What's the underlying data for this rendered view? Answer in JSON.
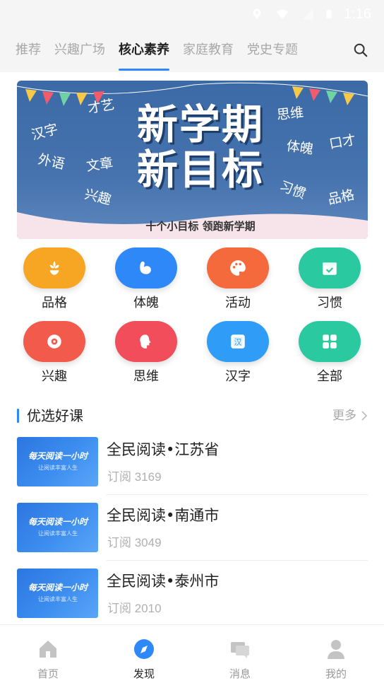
{
  "status_bar": {
    "time": "1:16"
  },
  "tabs": [
    {
      "label": "推荐"
    },
    {
      "label": "兴趣广场"
    },
    {
      "label": "核心素养",
      "active": true
    },
    {
      "label": "家庭教育"
    },
    {
      "label": "党史专题"
    }
  ],
  "banner": {
    "title_line1": "新学期",
    "title_line2": "新目标",
    "subtitle": "十个小目标 领跑新学期",
    "words": [
      "才艺",
      "汉字",
      "外语",
      "文章",
      "兴趣",
      "思维",
      "体魄",
      "口才",
      "习惯",
      "品格"
    ]
  },
  "categories": [
    {
      "label": "品格",
      "icon": "flower-icon",
      "color": "#f7a623"
    },
    {
      "label": "体魄",
      "icon": "muscle-icon",
      "color": "#2f88f7"
    },
    {
      "label": "活动",
      "icon": "palette-icon",
      "color": "#f46a3c"
    },
    {
      "label": "习惯",
      "icon": "calendar-icon",
      "color": "#2bc9a0"
    },
    {
      "label": "兴趣",
      "icon": "target-icon",
      "color": "#f25b4c"
    },
    {
      "label": "思维",
      "icon": "brain-icon",
      "color": "#f24d5b"
    },
    {
      "label": "汉字",
      "icon": "character-icon",
      "color": "#2f9df7"
    },
    {
      "label": "全部",
      "icon": "grid-icon",
      "color": "#2bc9a0"
    }
  ],
  "section": {
    "title": "优选好课",
    "more": "更多"
  },
  "courses": [
    {
      "name": "全民阅读•江苏省",
      "sub": "订阅 3169",
      "thumb_title": "每天阅读一小时",
      "thumb_sub": "让阅读丰富人生"
    },
    {
      "name": "全民阅读•南通市",
      "sub": "订阅 3049",
      "thumb_title": "每天阅读一小时",
      "thumb_sub": "让阅读丰富人生"
    },
    {
      "name": "全民阅读•泰州市",
      "sub": "订阅 2010",
      "thumb_title": "每天阅读一小时",
      "thumb_sub": "让阅读丰富人生"
    }
  ],
  "bottom_nav": [
    {
      "label": "首页",
      "icon": "home-icon"
    },
    {
      "label": "发现",
      "icon": "compass-icon",
      "active": true
    },
    {
      "label": "消息",
      "icon": "message-icon"
    },
    {
      "label": "我的",
      "icon": "person-icon"
    }
  ],
  "colors": {
    "accent": "#2f88f7",
    "inactive": "#a8a8a8"
  }
}
